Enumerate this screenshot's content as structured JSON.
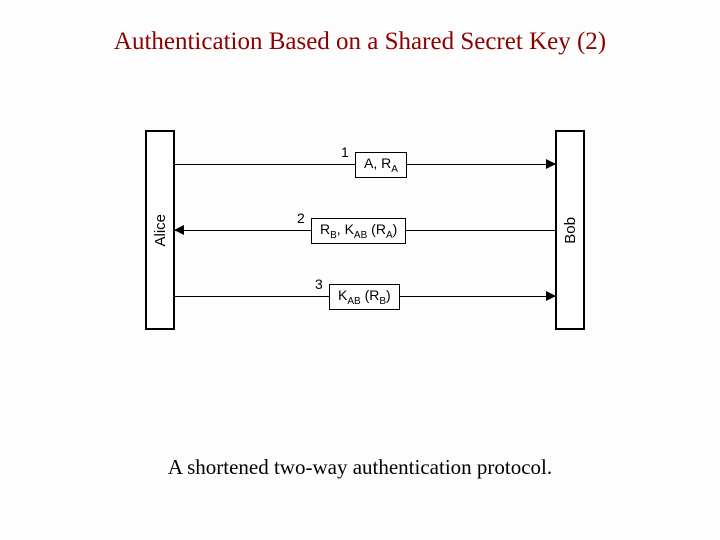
{
  "title": "Authentication Based on a Shared Secret Key (2)",
  "caption": "A shortened two-way authentication protocol.",
  "parties": {
    "left": "Alice",
    "right": "Bob"
  },
  "messages": {
    "step1": {
      "num": "1",
      "text_html": "A, R<span class=\"sub\">A</span>"
    },
    "step2": {
      "num": "2",
      "text_html": "R<span class=\"sub\">B</span>, K<span class=\"sub\">AB</span> (R<span class=\"sub\">A</span>)"
    },
    "step3": {
      "num": "3",
      "text_html": "K<span class=\"sub\">AB</span> (R<span class=\"sub\">B</span>)"
    }
  },
  "chart_data": {
    "type": "table",
    "title": "Shortened two-way authentication protocol",
    "parties": [
      "Alice",
      "Bob"
    ],
    "steps": [
      {
        "step": 1,
        "from": "Alice",
        "to": "Bob",
        "message": "A, R_A"
      },
      {
        "step": 2,
        "from": "Bob",
        "to": "Alice",
        "message": "R_B, K_AB(R_A)"
      },
      {
        "step": 3,
        "from": "Alice",
        "to": "Bob",
        "message": "K_AB(R_B)"
      }
    ]
  }
}
